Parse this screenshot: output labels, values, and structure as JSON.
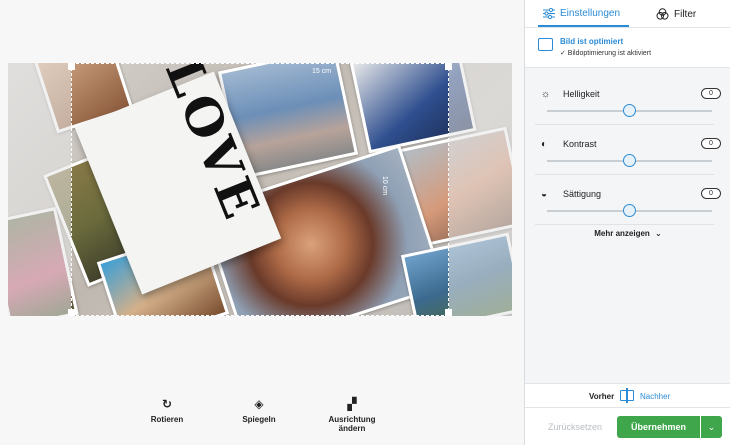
{
  "canvas": {
    "dimension_top": "15 cm",
    "dimension_right": "10 cm",
    "love_letters": "LOVE"
  },
  "toolbar": {
    "rotate": "Rotieren",
    "mirror": "Spiegeln",
    "orientation": "Ausrichtung ändern"
  },
  "panel": {
    "tab_settings": "Einstellungen",
    "tab_filter": "Filter",
    "optimized_title": "Bild ist optimiert",
    "optimized_sub": "✓ Bildoptimierung ist aktiviert",
    "sliders": [
      {
        "label": "Helligkeit",
        "value": "0",
        "icon": "sun-icon",
        "level": 0.5
      },
      {
        "label": "Kontrast",
        "value": "0",
        "icon": "contrast-icon",
        "level": 0.5
      },
      {
        "label": "Sättigung",
        "value": "0",
        "icon": "saturation-icon",
        "level": 0.5
      }
    ],
    "more": "Mehr anzeigen",
    "before": "Vorher",
    "after": "Nachher",
    "reset": "Zurücksetzen",
    "apply": "Übernehmen"
  },
  "colors": {
    "accent": "#2a8bd6",
    "apply": "#3fa64b"
  }
}
